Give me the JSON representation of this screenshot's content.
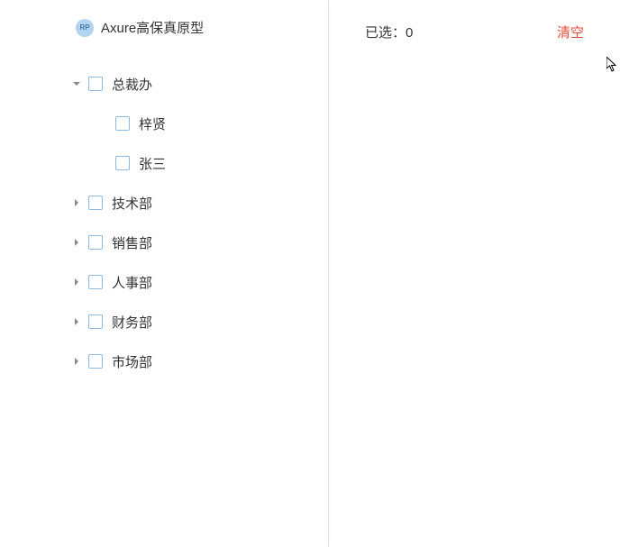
{
  "header": {
    "badge_text": "RP",
    "title": "Axure高保真原型"
  },
  "tree": {
    "items": [
      {
        "label": "总裁办",
        "expanded": true,
        "is_parent": true,
        "level": 0
      },
      {
        "label": "梓贤",
        "expanded": false,
        "is_parent": false,
        "level": 1
      },
      {
        "label": "张三",
        "expanded": false,
        "is_parent": false,
        "level": 1
      },
      {
        "label": "技术部",
        "expanded": false,
        "is_parent": true,
        "level": 0
      },
      {
        "label": "销售部",
        "expanded": false,
        "is_parent": true,
        "level": 0
      },
      {
        "label": "人事部",
        "expanded": false,
        "is_parent": true,
        "level": 0
      },
      {
        "label": "财务部",
        "expanded": false,
        "is_parent": true,
        "level": 0
      },
      {
        "label": "市场部",
        "expanded": false,
        "is_parent": true,
        "level": 0
      }
    ]
  },
  "right": {
    "selected_prefix": "已选：",
    "selected_count": "0",
    "clear_label": "清空"
  },
  "colors": {
    "checkbox_border": "#8fb8e0",
    "toggle_fill": "#888",
    "clear_color": "#e74c3c"
  }
}
